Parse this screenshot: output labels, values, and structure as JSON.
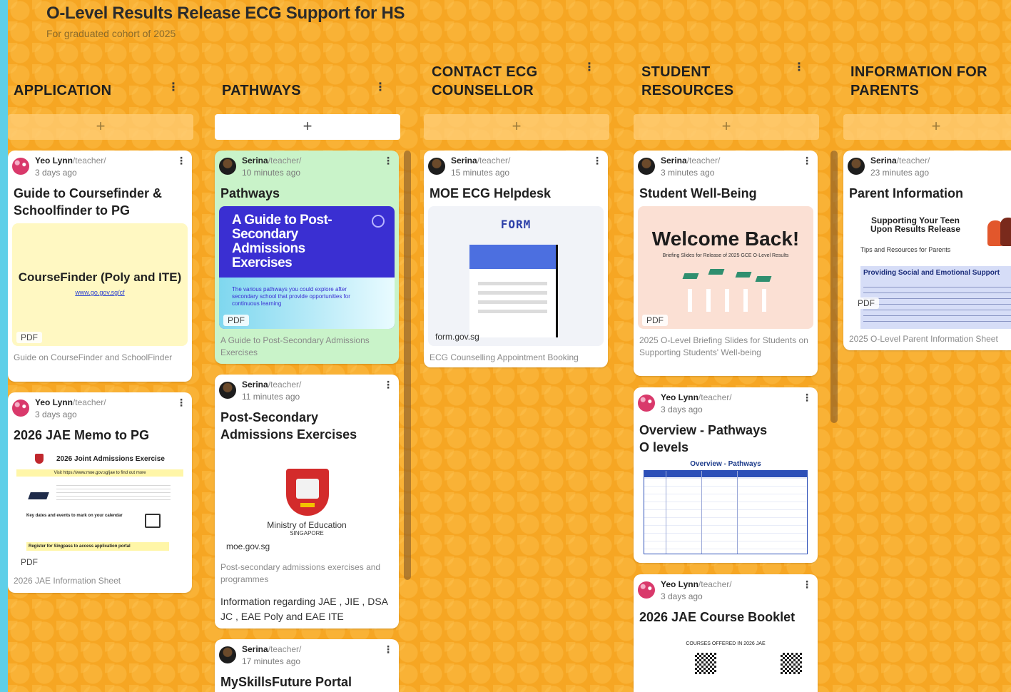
{
  "board": {
    "title": "O-Level Results Release ECG Support for HS",
    "subtitle": "For graduated cohort of 2025",
    "accent": "#f6a623"
  },
  "columns": [
    {
      "title": "APPLICATION",
      "menu": "⋮",
      "add": "+"
    },
    {
      "title": "PATHWAYS",
      "menu": "⋮",
      "add": "+"
    },
    {
      "title": "CONTACT ECG COUNSELLOR",
      "menu": "⋮",
      "add": "+"
    },
    {
      "title": "STUDENT RESOURCES",
      "menu": "⋮",
      "add": "+"
    },
    {
      "title": "INFORMATION FOR PARENTS",
      "menu": "⋮",
      "add": "+"
    }
  ],
  "cards": {
    "c1": {
      "author": "Yeo Lynn",
      "role": "/teacher/",
      "time": "3 days ago",
      "title": "Guide to Coursefinder & Schoolfinder to PG",
      "preview_title": "CourseFinder (Poly and ITE)",
      "preview_link": "www.go.gov.sg/cf",
      "tag": "PDF",
      "desc": "Guide on CourseFinder and SchoolFinder"
    },
    "c2": {
      "author": "Yeo Lynn",
      "role": "/teacher/",
      "time": "3 days ago",
      "title": "2026 JAE Memo to PG",
      "preview_title": "2026 Joint Admissions Exercise",
      "preview_visit": "Visit https://www.moe.gov.sg/jae to find out more",
      "preview_key": "Key dates and events to mark on your calendar",
      "preview_register": "Register for Singpass to access application portal",
      "tag": "PDF",
      "desc": "2026 JAE Information Sheet"
    },
    "p1": {
      "author": "Serina",
      "role": "/teacher/",
      "time": "10 minutes ago",
      "title": "Pathways",
      "preview_title": "A Guide to Post-Secondary Admissions Exercises",
      "preview_sub": "The various pathways you could explore after secondary school that provide opportunities for continuous learning",
      "tag": "PDF",
      "desc": "A Guide to Post-Secondary Admissions Exercises"
    },
    "p2": {
      "author": "Serina",
      "role": "/teacher/",
      "time": "11 minutes ago",
      "title": "Post-Secondary Admissions Exercises",
      "preview_org": "Ministry of Education",
      "preview_country": "SINGAPORE",
      "link": "moe.gov.sg",
      "desc": "Post-secondary admissions exercises and programmes",
      "body": "Information regarding JAE , JIE , DSA JC , EAE Poly and EAE ITE"
    },
    "p3": {
      "author": "Serina",
      "role": "/teacher/",
      "time": "17 minutes ago",
      "title": "MySkillsFuture Portal"
    },
    "e1": {
      "author": "Serina",
      "role": "/teacher/",
      "time": "15 minutes ago",
      "title": "MOE ECG Helpdesk",
      "preview_logo": "FORM",
      "link": "form.gov.sg",
      "desc": "ECG Counselling Appointment Booking"
    },
    "s1": {
      "author": "Serina",
      "role": "/teacher/",
      "time": "3 minutes ago",
      "title": "Student Well-Being",
      "preview_title": "Welcome Back!",
      "preview_sub": "Briefing Slides for Release of 2025 GCE O-Level Results",
      "tag": "PDF",
      "desc": "2025 O-Level Briefing Slides for Students on Supporting Students' Well-being"
    },
    "s2": {
      "author": "Yeo Lynn",
      "role": "/teacher/",
      "time": "3 days ago",
      "title": "Overview  - Pathways O levels",
      "preview_title": "Overview - Pathways"
    },
    "s3": {
      "author": "Yeo Lynn",
      "role": "/teacher/",
      "time": "3 days ago",
      "title": "2026 JAE Course Booklet",
      "preview_title": "COURSES OFFERED IN 2026 JAE"
    },
    "i1": {
      "author": "Serina",
      "role": "/teacher/",
      "time": "23 minutes ago",
      "title": "Parent Information",
      "preview_title": "Supporting Your Teen Upon Results Release",
      "preview_sub": "Tips and Resources for Parents",
      "preview_section": "Providing Social and Emotional Support",
      "tag": "PDF",
      "desc": "2025 O-Level Parent Information Sheet"
    }
  }
}
